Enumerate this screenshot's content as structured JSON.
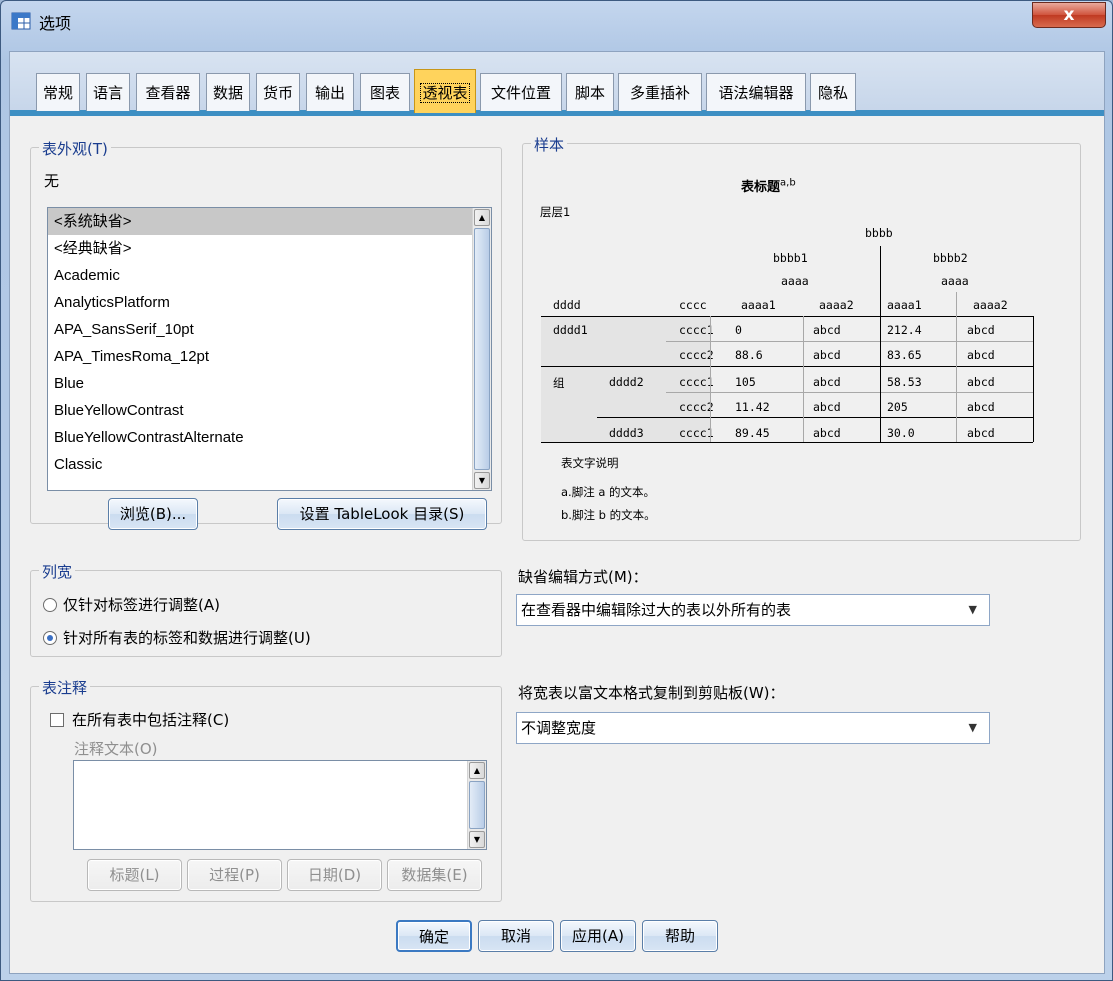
{
  "window": {
    "title": "选项",
    "close_label": "x"
  },
  "tabs": [
    {
      "label": "常规"
    },
    {
      "label": "语言"
    },
    {
      "label": "查看器"
    },
    {
      "label": "数据"
    },
    {
      "label": "货币"
    },
    {
      "label": "输出"
    },
    {
      "label": "图表"
    },
    {
      "label": "透视表",
      "active": true
    },
    {
      "label": "文件位置"
    },
    {
      "label": "脚本"
    },
    {
      "label": "多重插补"
    },
    {
      "label": "语法编辑器"
    },
    {
      "label": "隐私"
    }
  ],
  "table_looks": {
    "legend": "表外观(T)",
    "current": "无",
    "items": [
      "<系统缺省>",
      "<经典缺省>",
      "Academic",
      "AnalyticsPlatform",
      "APA_SansSerif_10pt",
      "APA_TimesRoma_12pt",
      "Blue",
      "BlueYellowContrast",
      "BlueYellowContrastAlternate",
      "Classic"
    ],
    "selected_index": 0,
    "browse_label": "浏览(B)...",
    "set_dir_label": "设置 TableLook 目录(S)"
  },
  "sample": {
    "legend": "样本",
    "title": "表标题",
    "title_sup": "a,b",
    "layer": "层层1",
    "header_top": "bbbb",
    "header_b1": "bbbb1",
    "header_b2": "bbbb2",
    "header_a1": "aaaa",
    "header_a2": "aaaa",
    "col_labels": [
      "dddd",
      "cccc",
      "aaaa1",
      "aaaa2",
      "aaaa1",
      "aaaa2"
    ],
    "rows": [
      {
        "d": "dddd1",
        "d2": "",
        "c": "cccc1",
        "v": [
          "0",
          "abcd",
          "212.4",
          "abcd"
        ]
      },
      {
        "d": "",
        "d2": "",
        "c": "cccc2",
        "v": [
          "88.6",
          "abcd",
          "83.65",
          "abcd"
        ]
      },
      {
        "d": "组",
        "d2": "dddd2",
        "c": "cccc1",
        "v": [
          "105",
          "abcd",
          "58.53",
          "abcd"
        ]
      },
      {
        "d": "",
        "d2": "",
        "c": "cccc2",
        "v": [
          "11.42",
          "abcd",
          "205",
          "abcd"
        ]
      },
      {
        "d": "",
        "d2": "dddd3",
        "c": "cccc1",
        "v": [
          "89.45",
          "abcd",
          "30.0",
          "abcd"
        ]
      }
    ],
    "caption": "表文字说明",
    "footnote_a": "a.脚注 a 的文本。",
    "footnote_b": "b.脚注 b 的文本。"
  },
  "column_width": {
    "legend": "列宽",
    "option1": "仅针对标签进行调整(A)",
    "option2": "针对所有表的标签和数据进行调整(U)",
    "selected": 2
  },
  "default_edit": {
    "label": "缺省编辑方式(M)：",
    "value": "在查看器中编辑除过大的表以外所有的表"
  },
  "copy_wide": {
    "label": "将宽表以富文本格式复制到剪贴板(W)：",
    "value": "不调整宽度"
  },
  "comments": {
    "legend": "表注释",
    "include_label": "在所有表中包括注释(C)",
    "include_checked": false,
    "comment_text_label": "注释文本(O)",
    "buttons": [
      "标题(L)",
      "过程(P)",
      "日期(D)",
      "数据集(E)"
    ]
  },
  "footer_buttons": {
    "ok": "确定",
    "cancel": "取消",
    "apply": "应用(A)",
    "help": "帮助"
  }
}
